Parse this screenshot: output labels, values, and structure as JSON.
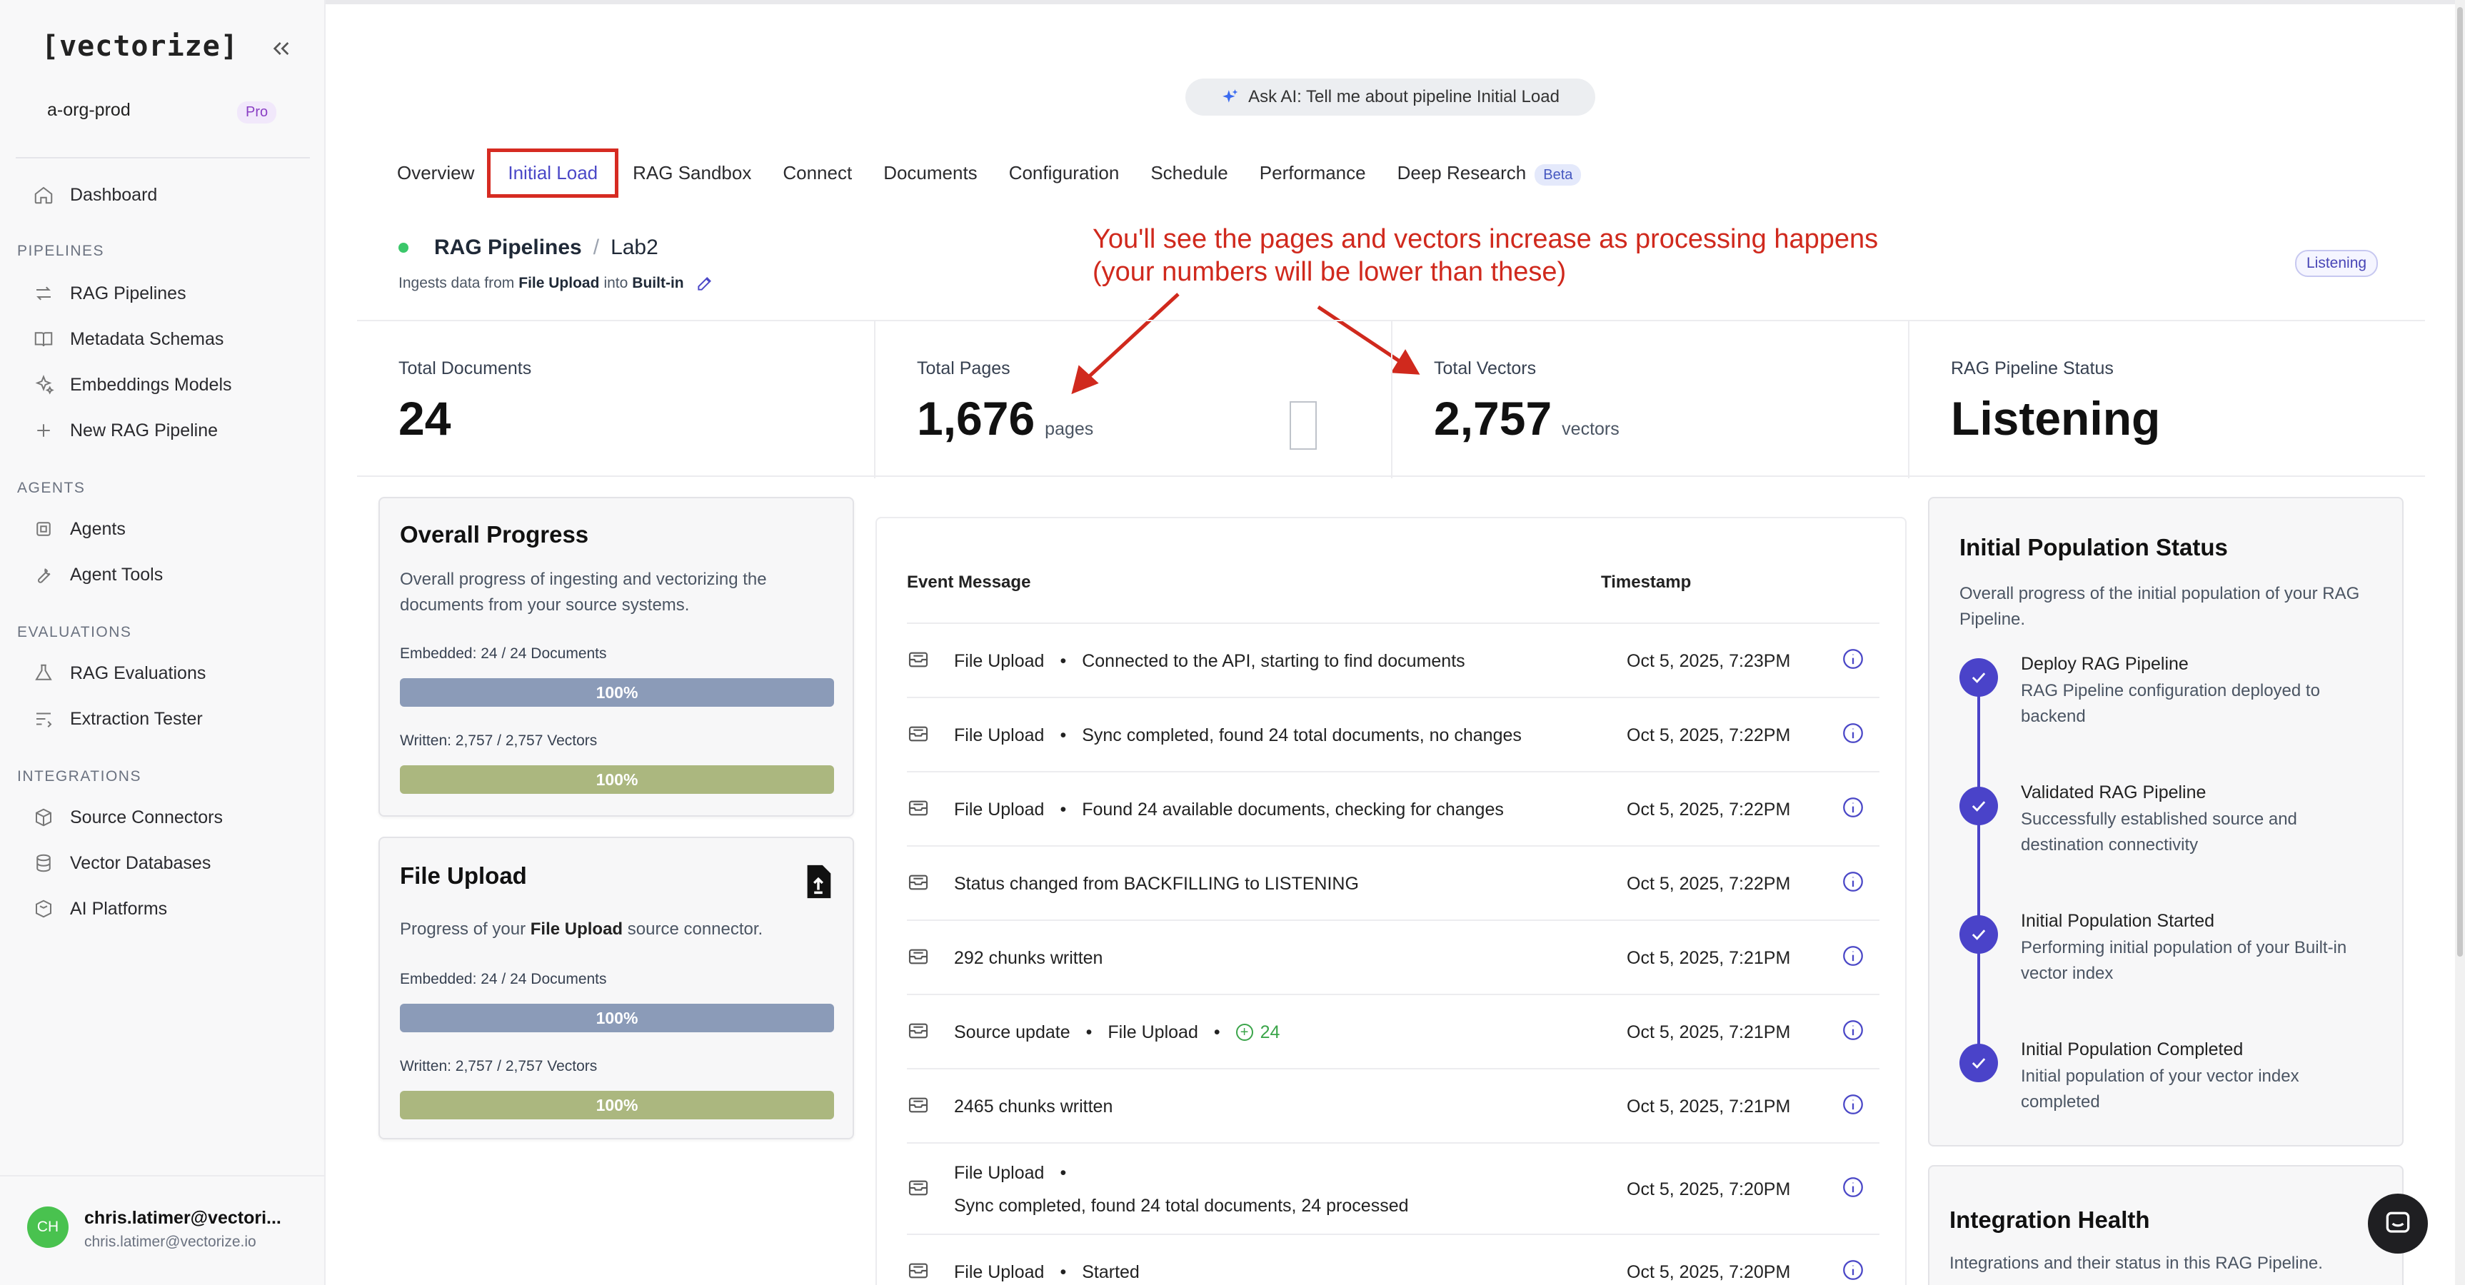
{
  "sidebar": {
    "logo": "[vectorize]",
    "org": "a-org-prod",
    "plan": "Pro",
    "dashboard": "Dashboard",
    "sections": {
      "pipelines": "PIPELINES",
      "agents": "AGENTS",
      "evaluations": "EVALUATIONS",
      "integrations": "INTEGRATIONS"
    },
    "items": {
      "rag_pipelines": "RAG Pipelines",
      "metadata_schemas": "Metadata Schemas",
      "embeddings_models": "Embeddings Models",
      "new_rag_pipeline": "New RAG Pipeline",
      "agents": "Agents",
      "agent_tools": "Agent Tools",
      "rag_evaluations": "RAG Evaluations",
      "extraction_tester": "Extraction Tester",
      "source_connectors": "Source Connectors",
      "vector_databases": "Vector Databases",
      "ai_platforms": "AI Platforms"
    },
    "user": {
      "initials": "CH",
      "name": "chris.latimer@vectori...",
      "email": "chris.latimer@vectorize.io"
    }
  },
  "ask_ai": "Ask AI: Tell me about pipeline Initial Load",
  "tabs": {
    "overview": "Overview",
    "initial_load": "Initial Load",
    "rag_sandbox": "RAG Sandbox",
    "connect": "Connect",
    "documents": "Documents",
    "configuration": "Configuration",
    "schedule": "Schedule",
    "performance": "Performance",
    "deep_research": "Deep Research",
    "beta": "Beta"
  },
  "breadcrumb": {
    "root": "RAG Pipelines",
    "sep": "/",
    "current": "Lab2"
  },
  "ingest": {
    "prefix": "Ingests data from",
    "source": "File Upload",
    "middle": "into",
    "target": "Built-in"
  },
  "status_badge": "Listening",
  "annotation": {
    "line1": "You'll see the pages and vectors increase as processing happens",
    "line2": "(your numbers will be lower than these)"
  },
  "stats": {
    "documents": {
      "label": "Total Documents",
      "value": "24"
    },
    "pages": {
      "label": "Total Pages",
      "value": "1,676",
      "unit": "pages"
    },
    "vectors": {
      "label": "Total Vectors",
      "value": "2,757",
      "unit": "vectors"
    },
    "status": {
      "label": "RAG Pipeline Status",
      "value": "Listening"
    }
  },
  "overall_progress": {
    "title": "Overall Progress",
    "desc": "Overall progress of ingesting and vectorizing the documents from your source systems.",
    "embedded_label": "Embedded: 24 / 24 Documents",
    "embedded_pct": "100%",
    "written_label": "Written: 2,757 / 2,757 Vectors",
    "written_pct": "100%"
  },
  "file_upload": {
    "title": "File Upload",
    "desc_prefix": "Progress of your",
    "desc_bold": "File Upload",
    "desc_suffix": "source connector.",
    "embedded_label": "Embedded: 24 / 24 Documents",
    "embedded_pct": "100%",
    "written_label": "Written: 2,757 / 2,757 Vectors",
    "written_pct": "100%"
  },
  "events": {
    "col_message": "Event Message",
    "col_timestamp": "Timestamp",
    "rows": [
      {
        "source": "File Upload",
        "sep": "•",
        "message": "Connected to the API, starting to find documents",
        "time": "Oct 5, 2025, 7:23PM"
      },
      {
        "source": "File Upload",
        "sep": "•",
        "message": "Sync completed, found 24 total documents, no changes",
        "time": "Oct 5, 2025, 7:22PM"
      },
      {
        "source": "File Upload",
        "sep": "•",
        "message": "Found 24 available documents, checking for changes",
        "time": "Oct 5, 2025, 7:22PM"
      },
      {
        "message": "Status changed from BACKFILLING to LISTENING",
        "time": "Oct 5, 2025, 7:22PM"
      },
      {
        "message": "292 chunks written",
        "time": "Oct 5, 2025, 7:21PM"
      },
      {
        "message": "Source update",
        "sep": "•",
        "source": "File Upload",
        "sep2": "•",
        "added": "24",
        "time": "Oct 5, 2025, 7:21PM"
      },
      {
        "message": "2465 chunks written",
        "time": "Oct 5, 2025, 7:21PM"
      },
      {
        "source": "File Upload",
        "sep": "•",
        "message": "Sync completed, found 24 total documents, 24 processed",
        "time": "Oct 5, 2025, 7:20PM"
      },
      {
        "source": "File Upload",
        "sep": "•",
        "message": "Started",
        "time": "Oct 5, 2025, 7:20PM"
      }
    ]
  },
  "initial_population": {
    "title": "Initial Population Status",
    "desc": "Overall progress of the initial population of your RAG Pipeline.",
    "steps": [
      {
        "title": "Deploy RAG Pipeline",
        "desc": "RAG Pipeline configuration deployed to backend"
      },
      {
        "title": "Validated RAG Pipeline",
        "desc": "Successfully established source and destination connectivity"
      },
      {
        "title": "Initial Population Started",
        "desc": "Performing initial population of your Built-in vector index"
      },
      {
        "title": "Initial Population Completed",
        "desc": "Initial population of your vector index completed"
      }
    ]
  },
  "integration_health": {
    "title": "Integration Health",
    "desc": "Integrations and their status in this RAG Pipeline."
  },
  "colors": {
    "accent": "#4b48c7",
    "annotation": "#d0291d",
    "progress_blue": "#8b9bb8",
    "progress_olive": "#abb77f",
    "listening_dot": "#3bc76a"
  }
}
